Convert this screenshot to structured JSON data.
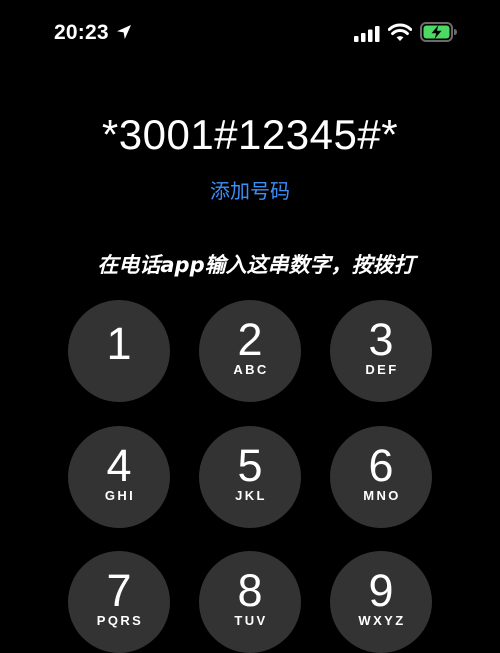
{
  "status_bar": {
    "time": "20:23",
    "icons": [
      "location-arrow-icon",
      "cellular-signal-icon",
      "wifi-icon",
      "battery-charging-icon"
    ],
    "battery_color": "#4cd964"
  },
  "dialer": {
    "number": "*3001#12345#*",
    "add_number_label": "添加号码",
    "accent_color": "#3e8ef7"
  },
  "caption": "在电话app输入这串数字，按拨打",
  "keypad": [
    {
      "digit": "1",
      "letters": ""
    },
    {
      "digit": "2",
      "letters": "ABC"
    },
    {
      "digit": "3",
      "letters": "DEF"
    },
    {
      "digit": "4",
      "letters": "GHI"
    },
    {
      "digit": "5",
      "letters": "JKL"
    },
    {
      "digit": "6",
      "letters": "MNO"
    },
    {
      "digit": "7",
      "letters": "PQRS"
    },
    {
      "digit": "8",
      "letters": "TUV"
    },
    {
      "digit": "9",
      "letters": "WXYZ"
    }
  ]
}
